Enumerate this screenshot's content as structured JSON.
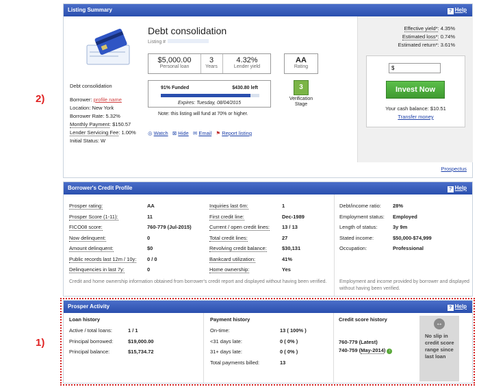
{
  "annotations": {
    "label_2": "2)",
    "label_1": "1)"
  },
  "listing_summary": {
    "header": "Listing Summary",
    "help": "Help",
    "title": "Debt consolidation",
    "listing_prefix": "Listing #",
    "desc": "Debt consolidation",
    "borrower_label": "Borrower:",
    "borrower_name": "profile name",
    "location": "Location: New York",
    "borrower_rate": "Borrower Rate: 5.32%",
    "monthly_payment_label": "Monthly Payment",
    "monthly_payment_value": ": $150.57",
    "servicing_fee_label": "Lender Servicing Fee",
    "servicing_fee_value": ": 1.00%",
    "initial_status": "Initial Status: W",
    "amount": "$5,000.00",
    "amount_sub": "Personal loan",
    "term": "3",
    "term_sub": "Years",
    "yield": "4.32%",
    "yield_sub": "Lender yield",
    "rating": "AA",
    "rating_sub": "Rating",
    "funded_pct": "91% Funded",
    "funded_fraction": 0.91,
    "amount_left": "$430.80 left",
    "expires": "Expires: Tuesday, 08/04/2015",
    "fund_note": "Note: this listing will fund at 70% or higher.",
    "verification_num": "3",
    "verification_label": "Verification Stage",
    "actions": [
      "Watch",
      "Hide",
      "Email",
      "Report listing"
    ],
    "effective_yield_label": "Effective yield*",
    "effective_yield_value": ": 4.35%",
    "estimated_loss_label": "Estimated loss*",
    "estimated_loss_value": ": 0.74%",
    "estimated_return_label": "Estimated return*",
    "estimated_return_value": ": 3.61%",
    "invest_input": "$",
    "invest_button": "Invest Now",
    "cash_balance": "Your cash balance: $10.51",
    "transfer": "Transfer money",
    "prospectus": "Prospectus"
  },
  "credit_profile": {
    "header": "Borrower's Credit Profile",
    "help": "Help",
    "col1": [
      {
        "label": "Prosper rating:",
        "value": "AA"
      },
      {
        "label": "Prosper Score (1-11):",
        "value": "11"
      },
      {
        "label": "FICO08 score:",
        "value": "760-779 (Jul-2015)"
      },
      {
        "label": "Now delinquent:",
        "value": "0"
      },
      {
        "label": "Amount delinquent:",
        "value": "$0"
      },
      {
        "label": "Public records last 12m / 10y:",
        "value": "0 / 0"
      },
      {
        "label": "Delinquencies in last 7y:",
        "value": "0"
      }
    ],
    "col2": [
      {
        "label": "Inquiries last 6m:",
        "value": "1"
      },
      {
        "label": "First credit line:",
        "value": "Dec-1989"
      },
      {
        "label": "Current / open credit lines:",
        "value": "13 / 13"
      },
      {
        "label": "Total credit lines:",
        "value": "27"
      },
      {
        "label": "Revolving credit balance:",
        "value": "$30,131"
      },
      {
        "label": "Bankcard utilization:",
        "value": "41%"
      },
      {
        "label": "Home ownership:",
        "value": "Yes"
      }
    ],
    "col3": [
      {
        "label": "Debt/income ratio:",
        "value": "28%"
      },
      {
        "label": "Employment status:",
        "value": "Employed"
      },
      {
        "label": "Length of status:",
        "value": "3y 9m"
      },
      {
        "label": "Stated income:",
        "value": "$50,000-$74,999"
      },
      {
        "label": "Occupation:",
        "value": "Professional"
      }
    ],
    "note_left": "Credit and home ownership information obtained from borrower's credit report and displayed without having been verified.",
    "note_right": "Employment and income provided by borrower and displayed without having been verified."
  },
  "prosper_activity": {
    "header": "Prosper Activity",
    "help": "Help",
    "loan_history_title": "Loan history",
    "loan_history": [
      {
        "label": "Active / total loans:",
        "value": "1 / 1"
      },
      {
        "label": "Principal borrowed:",
        "value": "$19,000.00"
      },
      {
        "label": "Principal balance:",
        "value": "$15,734.72"
      }
    ],
    "payment_history_title": "Payment history",
    "payment_history": [
      {
        "label": "On-time:",
        "value": "13 ( 100% )"
      },
      {
        "label": "<31 days late:",
        "value": "0 ( 0% )"
      },
      {
        "label": "31+ days late:",
        "value": "0 ( 0% )"
      },
      {
        "label": "Total payments billed:",
        "value": "13"
      }
    ],
    "credit_score_title": "Credit score history",
    "score_latest": "760-779 (Latest)",
    "score_prev_prefix": "740-759 (",
    "score_prev_date": "May-2014",
    "score_prev_suffix": ")",
    "slip_text": "No slip in credit score range since last loan"
  },
  "colors": {
    "header_blue": "#2a4fae",
    "invest_green": "#4aa63a",
    "annotation_red": "#e02020"
  }
}
